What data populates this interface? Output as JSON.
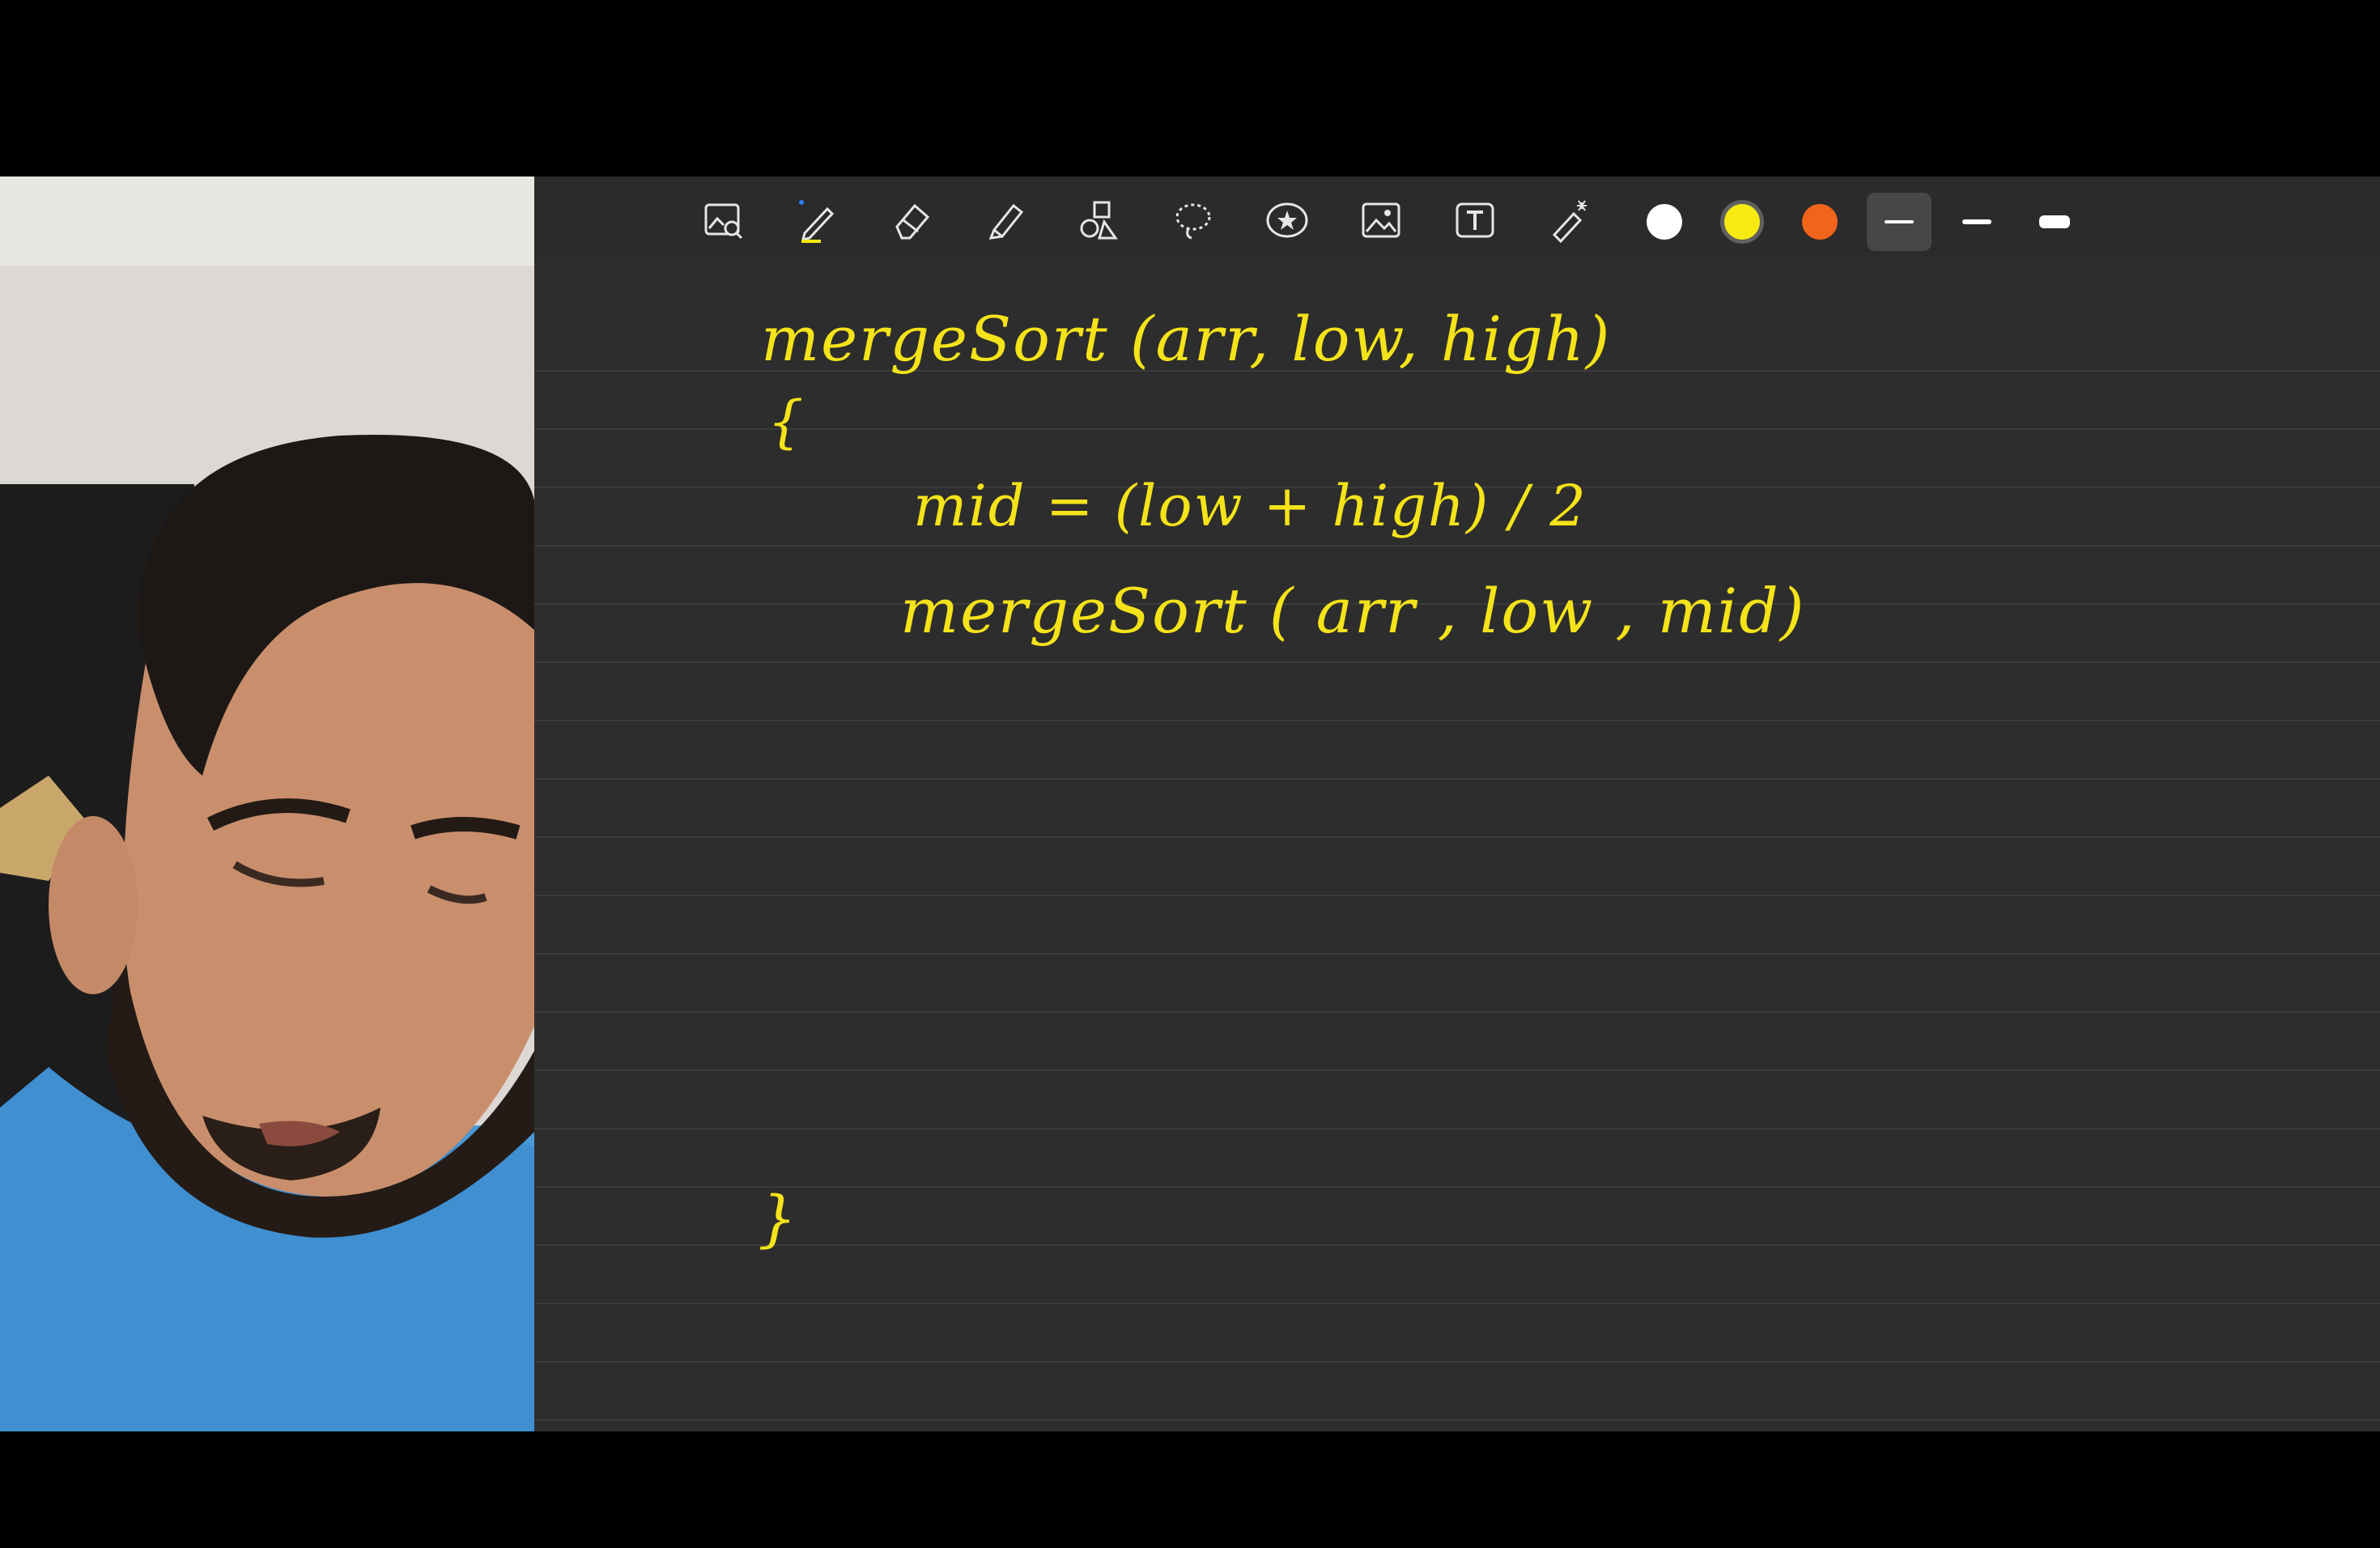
{
  "webcam": {
    "label": "presenter-video"
  },
  "toolbar": {
    "tools": [
      {
        "name": "photo-viewer",
        "icon": "image-zoom-icon"
      },
      {
        "name": "pen",
        "icon": "pen-icon",
        "selected": true
      },
      {
        "name": "eraser",
        "icon": "eraser-icon"
      },
      {
        "name": "highlighter",
        "icon": "highlighter-icon"
      },
      {
        "name": "shapes",
        "icon": "shapes-icon"
      },
      {
        "name": "lasso",
        "icon": "lasso-icon"
      },
      {
        "name": "stickers",
        "icon": "star-circle-icon"
      },
      {
        "name": "image",
        "icon": "image-icon"
      },
      {
        "name": "text",
        "icon": "text-box-icon"
      },
      {
        "name": "laser-pointer",
        "icon": "laser-pointer-icon"
      }
    ],
    "colors": [
      {
        "name": "white",
        "hex": "#ffffff"
      },
      {
        "name": "yellow",
        "hex": "#f6ea10",
        "selected": true
      },
      {
        "name": "orange",
        "hex": "#f2641a"
      }
    ],
    "thickness_options": [
      "thin",
      "medium",
      "thick"
    ],
    "selected_thickness": "thin"
  },
  "notes": {
    "ink_color": "#f5e31a",
    "lines": [
      {
        "text": "mergeSort (arr, low, high)"
      },
      {
        "text": "{"
      },
      {
        "text": "mid = (low + high) / 2"
      },
      {
        "text": "mergeSort ( arr , low , mid)"
      },
      {
        "text": "}"
      }
    ]
  }
}
